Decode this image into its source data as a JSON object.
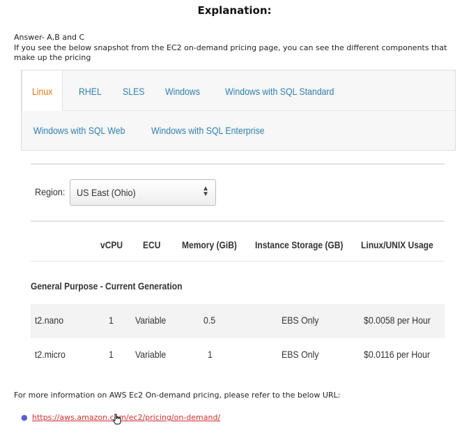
{
  "heading": "Explanation:",
  "answer": "Answer- A,B and C",
  "intro": "If you see the below snapshot from the EC2 on-demand pricing page, you can see the different components that make up the pricing",
  "snapshot": {
    "tabs_row1": [
      "Linux",
      "RHEL",
      "SLES",
      "Windows",
      "Windows with SQL Standard"
    ],
    "tabs_row2": [
      "Windows with SQL Web",
      "Windows with SQL Enterprise"
    ],
    "active_tab": "Linux",
    "region_label": "Region:",
    "region_value": "US East (Ohio)",
    "columns": [
      "vCPU",
      "ECU",
      "Memory (GiB)",
      "Instance Storage (GB)",
      "Linux/UNIX Usage"
    ],
    "group_title": "General Purpose - Current Generation",
    "rows": [
      {
        "name": "t2.nano",
        "vcpu": "1",
        "ecu": "Variable",
        "memory": "0.5",
        "storage": "EBS Only",
        "price": "$0.0058 per Hour"
      },
      {
        "name": "t2.micro",
        "vcpu": "1",
        "ecu": "Variable",
        "memory": "1",
        "storage": "EBS Only",
        "price": "$0.0116 per Hour"
      }
    ],
    "colors": {
      "active_tab": "#e47911",
      "tab_link": "#2f7fb0"
    }
  },
  "footer_text": "For more information on AWS Ec2 On-demand pricing, please refer to the below URL:",
  "url": "https://aws.amazon.com/ec2/pricing/on-demand/"
}
